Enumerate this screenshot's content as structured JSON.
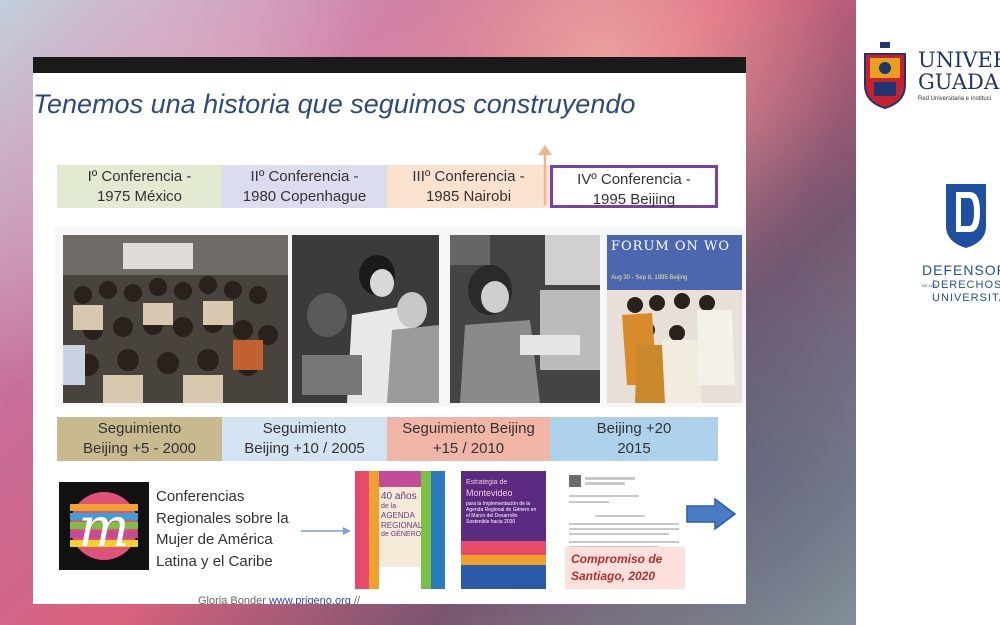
{
  "slide": {
    "title": "Tenemos una historia que seguimos construyendo",
    "conferences": [
      {
        "line1": "Iº Conferencia -",
        "line2": "1975 México"
      },
      {
        "line1": "IIº Conferencia -",
        "line2": "1980 Copenhague"
      },
      {
        "line1": "IIIº Conferencia -",
        "line2": "1985 Nairobi"
      },
      {
        "line1": "IVº Conferencia -",
        "line2": "1995 Beijing"
      }
    ],
    "photo4_banner": "FORUM ON WO",
    "photo4_date": "Aug 30 - Sep 8, 1995  Beijing",
    "followups": [
      {
        "line1": "Seguimiento",
        "line2": "Beijing +5 - 2000"
      },
      {
        "line1": "Seguimiento",
        "line2": "Beijing +10 / 2005"
      },
      {
        "line1": "Seguimiento Beijing",
        "line2": "+15 / 2010"
      },
      {
        "line1": "Beijing +20",
        "line2": "2015"
      }
    ],
    "regional": {
      "lines": [
        "Conferencias",
        "Regionales sobre la",
        "Mujer de América",
        "Latina y el Caribe"
      ]
    },
    "book1": {
      "title1": "40 años",
      "title2": "de la",
      "title3": "AGENDA",
      "title4": "REGIONAL",
      "title5": "de GÉNERO"
    },
    "book2": {
      "title1": "Estrategia de",
      "title2": "Montevideo",
      "title3": "para la Implementación de la Agenda Regional de Género en el Marco del Desarrollo Sostenible hacia 2030"
    },
    "compromiso": {
      "line1": "Compromiso de",
      "line2": "Santiago, 2020"
    },
    "credit": {
      "author": "Gloria Bonder",
      "link": "www.prigeno.org",
      "suffix": "//"
    }
  },
  "sidebar": {
    "university_name_line1": "UNIVERS",
    "university_name_line2": "GUADAL",
    "university_tagline": "Red Universitaria e Instituci",
    "defensoria_line1": "DEFENSORÍ",
    "defensoria_line2": "DERECHOS",
    "defensoria_line3": "UNIVERSITARIO",
    "defensoria_prefix": "DE LOS"
  },
  "colors": {
    "title": "#2e4a7a",
    "conf1_bg": "#e2ebd2",
    "conf2_bg": "#dcdcef",
    "conf3_bg": "#fbe2cf",
    "conf4_border": "#7a3fa8",
    "seg1_bg": "#c8b98e",
    "seg2_bg": "#d4e3f2",
    "seg3_bg": "#f0b5a6",
    "seg4_bg": "#aed2ec",
    "compromiso_text": "#b03030",
    "arrow_blue": "#4a7bc5",
    "univ_navy": "#1f3570"
  }
}
